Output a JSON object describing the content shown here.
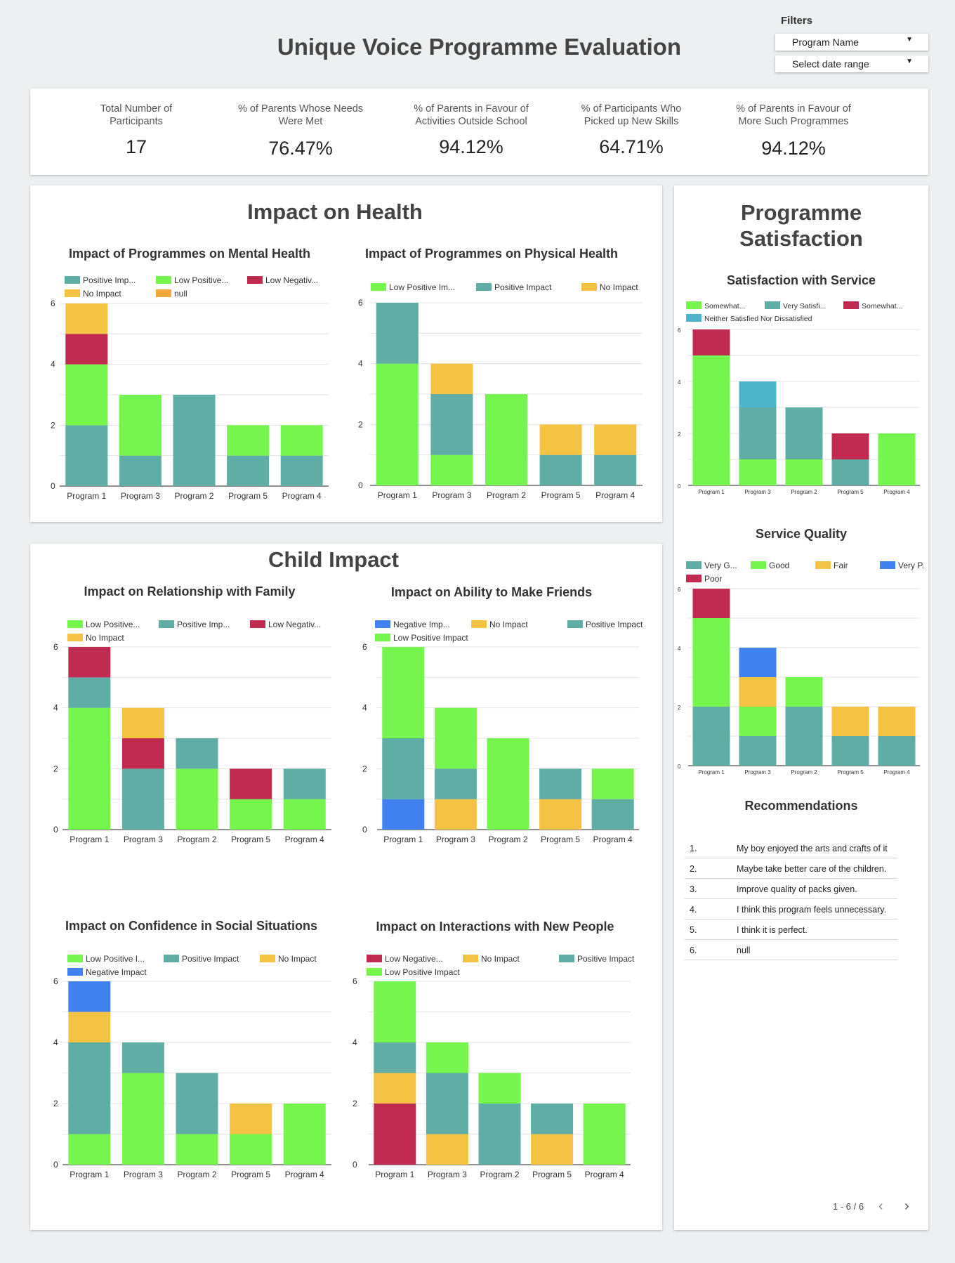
{
  "header": {
    "title": "Unique Voice Programme Evaluation"
  },
  "filters": {
    "label": "Filters",
    "program": "Program Name",
    "date": "Select date range"
  },
  "kpis": [
    {
      "label": "Total Number of Participants",
      "value": "17"
    },
    {
      "label": "% of Parents Whose Needs Were Met",
      "value": "76.47%"
    },
    {
      "label": "% of Parents in Favour of Activities Outside School",
      "value": "94.12%"
    },
    {
      "label": "% of Participants Who Picked up New Skills",
      "value": "64.71%"
    },
    {
      "label": "% of Parents in Favour of More Such Programmes",
      "value": "94.12%"
    }
  ],
  "sections": {
    "health": "Impact on Health",
    "child": "Child Impact",
    "satisfaction": "Programme Satisfaction",
    "recommendations": "Recommendations"
  },
  "colors": {
    "teal": "#5fada4",
    "green": "#76f54e",
    "red": "#c22b51",
    "yellow": "#f5c343",
    "orange": "#f3a93b",
    "blue": "#4282f0",
    "cyan": "#4db4c9"
  },
  "chart_data": [
    {
      "id": "mental",
      "type": "bar",
      "stacked": true,
      "title": "Impact of Programmes on Mental Health",
      "categories": [
        "Program 1",
        "Program 3",
        "Program 2",
        "Program 5",
        "Program 4"
      ],
      "ylim": [
        0,
        6
      ],
      "yticks": [
        0,
        2,
        4,
        6
      ],
      "legend": [
        {
          "label": "Positive Imp...",
          "color": "#5fada4"
        },
        {
          "label": "Low Positive...",
          "color": "#76f54e"
        },
        {
          "label": "Low Negativ...",
          "color": "#c22b51"
        },
        {
          "label": "No Impact",
          "color": "#f5c343"
        },
        {
          "label": "null",
          "color": "#f3a93b"
        }
      ],
      "series": [
        {
          "name": "Positive Impact",
          "color": "#5fada4",
          "values": [
            2,
            1,
            3,
            1,
            1
          ]
        },
        {
          "name": "Low Positive Impact",
          "color": "#76f54e",
          "values": [
            2,
            2,
            0,
            1,
            1
          ]
        },
        {
          "name": "Low Negative Impact",
          "color": "#c22b51",
          "values": [
            1,
            0,
            0,
            0,
            0
          ]
        },
        {
          "name": "No Impact",
          "color": "#f5c343",
          "values": [
            1,
            0,
            0,
            0,
            0
          ]
        },
        {
          "name": "null",
          "color": "#f3a93b",
          "values": [
            0,
            0,
            0,
            0,
            0
          ]
        }
      ]
    },
    {
      "id": "physical",
      "type": "bar",
      "stacked": true,
      "title": "Impact of Programmes on Physical Health",
      "categories": [
        "Program 1",
        "Program 3",
        "Program 2",
        "Program 5",
        "Program 4"
      ],
      "ylim": [
        0,
        6
      ],
      "yticks": [
        0,
        2,
        4,
        6
      ],
      "legend": [
        {
          "label": "Low Positive Im...",
          "color": "#76f54e"
        },
        {
          "label": "Positive Impact",
          "color": "#5fada4"
        },
        {
          "label": "No Impact",
          "color": "#f5c343"
        }
      ],
      "series": [
        {
          "name": "Low Positive Impact",
          "color": "#76f54e",
          "values": [
            4,
            1,
            3,
            0,
            0
          ]
        },
        {
          "name": "Positive Impact",
          "color": "#5fada4",
          "values": [
            2,
            2,
            0,
            1,
            1
          ]
        },
        {
          "name": "No Impact",
          "color": "#f5c343",
          "values": [
            0,
            1,
            0,
            1,
            1
          ]
        }
      ]
    },
    {
      "id": "family",
      "type": "bar",
      "stacked": true,
      "title": "Impact on Relationship with Family",
      "categories": [
        "Program 1",
        "Program 3",
        "Program 2",
        "Program 5",
        "Program 4"
      ],
      "ylim": [
        0,
        6
      ],
      "yticks": [
        0,
        2,
        4,
        6
      ],
      "legend": [
        {
          "label": "Low Positive...",
          "color": "#76f54e"
        },
        {
          "label": "Positive Imp...",
          "color": "#5fada4"
        },
        {
          "label": "Low Negativ...",
          "color": "#c22b51"
        },
        {
          "label": "No Impact",
          "color": "#f5c343"
        }
      ],
      "series": [
        {
          "name": "Low Positive Impact",
          "color": "#76f54e",
          "values": [
            4,
            0,
            2,
            1,
            1
          ]
        },
        {
          "name": "Positive Impact",
          "color": "#5fada4",
          "values": [
            1,
            2,
            1,
            0,
            1
          ]
        },
        {
          "name": "Low Negative Impact",
          "color": "#c22b51",
          "values": [
            1,
            1,
            0,
            1,
            0
          ]
        },
        {
          "name": "No Impact",
          "color": "#f5c343",
          "values": [
            0,
            1,
            0,
            0,
            0
          ]
        }
      ]
    },
    {
      "id": "friends",
      "type": "bar",
      "stacked": true,
      "title": "Impact on Ability to Make Friends",
      "categories": [
        "Program 1",
        "Program 3",
        "Program 2",
        "Program 5",
        "Program 4"
      ],
      "ylim": [
        0,
        6
      ],
      "yticks": [
        0,
        2,
        4,
        6
      ],
      "legend": [
        {
          "label": "Negative Imp...",
          "color": "#4282f0"
        },
        {
          "label": "No Impact",
          "color": "#f5c343"
        },
        {
          "label": "Positive Impact",
          "color": "#5fada4"
        },
        {
          "label": "Low Positive Impact",
          "color": "#76f54e"
        }
      ],
      "series": [
        {
          "name": "Negative Impact",
          "color": "#4282f0",
          "values": [
            1,
            0,
            0,
            0,
            0
          ]
        },
        {
          "name": "No Impact",
          "color": "#f5c343",
          "values": [
            0,
            1,
            0,
            1,
            0
          ]
        },
        {
          "name": "Positive Impact",
          "color": "#5fada4",
          "values": [
            2,
            1,
            0,
            1,
            1
          ]
        },
        {
          "name": "Low Positive Impact",
          "color": "#76f54e",
          "values": [
            3,
            2,
            3,
            0,
            1
          ]
        }
      ]
    },
    {
      "id": "confidence",
      "type": "bar",
      "stacked": true,
      "title": "Impact on Confidence in Social Situations",
      "categories": [
        "Program 1",
        "Program 3",
        "Program 2",
        "Program 5",
        "Program 4"
      ],
      "ylim": [
        0,
        6
      ],
      "yticks": [
        0,
        2,
        4,
        6
      ],
      "legend": [
        {
          "label": "Low Positive I...",
          "color": "#76f54e"
        },
        {
          "label": "Positive Impact",
          "color": "#5fada4"
        },
        {
          "label": "No Impact",
          "color": "#f5c343"
        },
        {
          "label": "Negative Impact",
          "color": "#4282f0"
        }
      ],
      "series": [
        {
          "name": "Low Positive Impact",
          "color": "#76f54e",
          "values": [
            1,
            3,
            1,
            1,
            2
          ]
        },
        {
          "name": "Positive Impact",
          "color": "#5fada4",
          "values": [
            3,
            1,
            2,
            0,
            0
          ]
        },
        {
          "name": "No Impact",
          "color": "#f5c343",
          "values": [
            1,
            0,
            0,
            1,
            0
          ]
        },
        {
          "name": "Negative Impact",
          "color": "#4282f0",
          "values": [
            1,
            0,
            0,
            0,
            0
          ]
        }
      ]
    },
    {
      "id": "newpeople",
      "type": "bar",
      "stacked": true,
      "title": "Impact on Interactions with New People",
      "categories": [
        "Program 1",
        "Program 3",
        "Program 2",
        "Program 5",
        "Program 4"
      ],
      "ylim": [
        0,
        6
      ],
      "yticks": [
        0,
        2,
        4,
        6
      ],
      "legend": [
        {
          "label": "Low Negative...",
          "color": "#c22b51"
        },
        {
          "label": "No Impact",
          "color": "#f5c343"
        },
        {
          "label": "Positive Impact",
          "color": "#5fada4"
        },
        {
          "label": "Low Positive Impact",
          "color": "#76f54e"
        }
      ],
      "series": [
        {
          "name": "Low Negative Impact",
          "color": "#c22b51",
          "values": [
            2,
            0,
            0,
            0,
            0
          ]
        },
        {
          "name": "No Impact",
          "color": "#f5c343",
          "values": [
            1,
            1,
            0,
            1,
            0
          ]
        },
        {
          "name": "Positive Impact",
          "color": "#5fada4",
          "values": [
            1,
            2,
            2,
            1,
            0
          ]
        },
        {
          "name": "Low Positive Impact",
          "color": "#76f54e",
          "values": [
            2,
            1,
            1,
            0,
            2
          ]
        }
      ]
    },
    {
      "id": "satisfaction",
      "type": "bar",
      "stacked": true,
      "title": "Satisfaction with Service",
      "categories": [
        "Program 1",
        "Program 3",
        "Program 2",
        "Program 5",
        "Program 4"
      ],
      "ylim": [
        0,
        6
      ],
      "yticks": [
        0,
        2,
        4,
        6
      ],
      "legend": [
        {
          "label": "Somewhat...",
          "color": "#76f54e"
        },
        {
          "label": "Very Satisfi...",
          "color": "#5fada4"
        },
        {
          "label": "Somewhat...",
          "color": "#c22b51"
        },
        {
          "label": "Neither Satisfied Nor Dissatisfied",
          "color": "#4db4c9"
        }
      ],
      "series": [
        {
          "name": "Somewhat Satisfied",
          "color": "#76f54e",
          "values": [
            5,
            1,
            1,
            0,
            2
          ]
        },
        {
          "name": "Very Satisfied",
          "color": "#5fada4",
          "values": [
            0,
            2,
            2,
            1,
            0
          ]
        },
        {
          "name": "Somewhat Dissatisfied",
          "color": "#c22b51",
          "values": [
            1,
            0,
            0,
            1,
            0
          ]
        },
        {
          "name": "Neither Satisfied Nor Dissatisfied",
          "color": "#4db4c9",
          "values": [
            0,
            1,
            0,
            0,
            0
          ]
        }
      ]
    },
    {
      "id": "quality",
      "type": "bar",
      "stacked": true,
      "title": "Service Quality",
      "categories": [
        "Program 1",
        "Program 3",
        "Program 2",
        "Program 5",
        "Program 4"
      ],
      "ylim": [
        0,
        6
      ],
      "yticks": [
        0,
        2,
        4,
        6
      ],
      "legend": [
        {
          "label": "Very G...",
          "color": "#5fada4"
        },
        {
          "label": "Good",
          "color": "#76f54e"
        },
        {
          "label": "Fair",
          "color": "#f5c343"
        },
        {
          "label": "Very P...",
          "color": "#4282f0"
        },
        {
          "label": "Poor",
          "color": "#c22b51"
        }
      ],
      "series": [
        {
          "name": "Very Good",
          "color": "#5fada4",
          "values": [
            2,
            1,
            2,
            1,
            1
          ]
        },
        {
          "name": "Good",
          "color": "#76f54e",
          "values": [
            3,
            1,
            1,
            0,
            0
          ]
        },
        {
          "name": "Fair",
          "color": "#f5c343",
          "values": [
            0,
            1,
            0,
            1,
            1
          ]
        },
        {
          "name": "Very Poor",
          "color": "#4282f0",
          "values": [
            0,
            1,
            0,
            0,
            0
          ]
        },
        {
          "name": "Poor",
          "color": "#c22b51",
          "values": [
            1,
            0,
            0,
            0,
            0
          ]
        }
      ]
    }
  ],
  "recommendations": [
    {
      "num": "1.",
      "text": "My boy enjoyed the arts and crafts of it"
    },
    {
      "num": "2.",
      "text": "Maybe take better care of the children."
    },
    {
      "num": "3.",
      "text": "Improve quality of packs given."
    },
    {
      "num": "4.",
      "text": "I think this program feels unnecessary."
    },
    {
      "num": "5.",
      "text": "I think it is perfect."
    },
    {
      "num": "6.",
      "text": "null"
    }
  ],
  "pagination": {
    "range": "1 - 6 / 6",
    "prev": "‹",
    "next": "›"
  }
}
